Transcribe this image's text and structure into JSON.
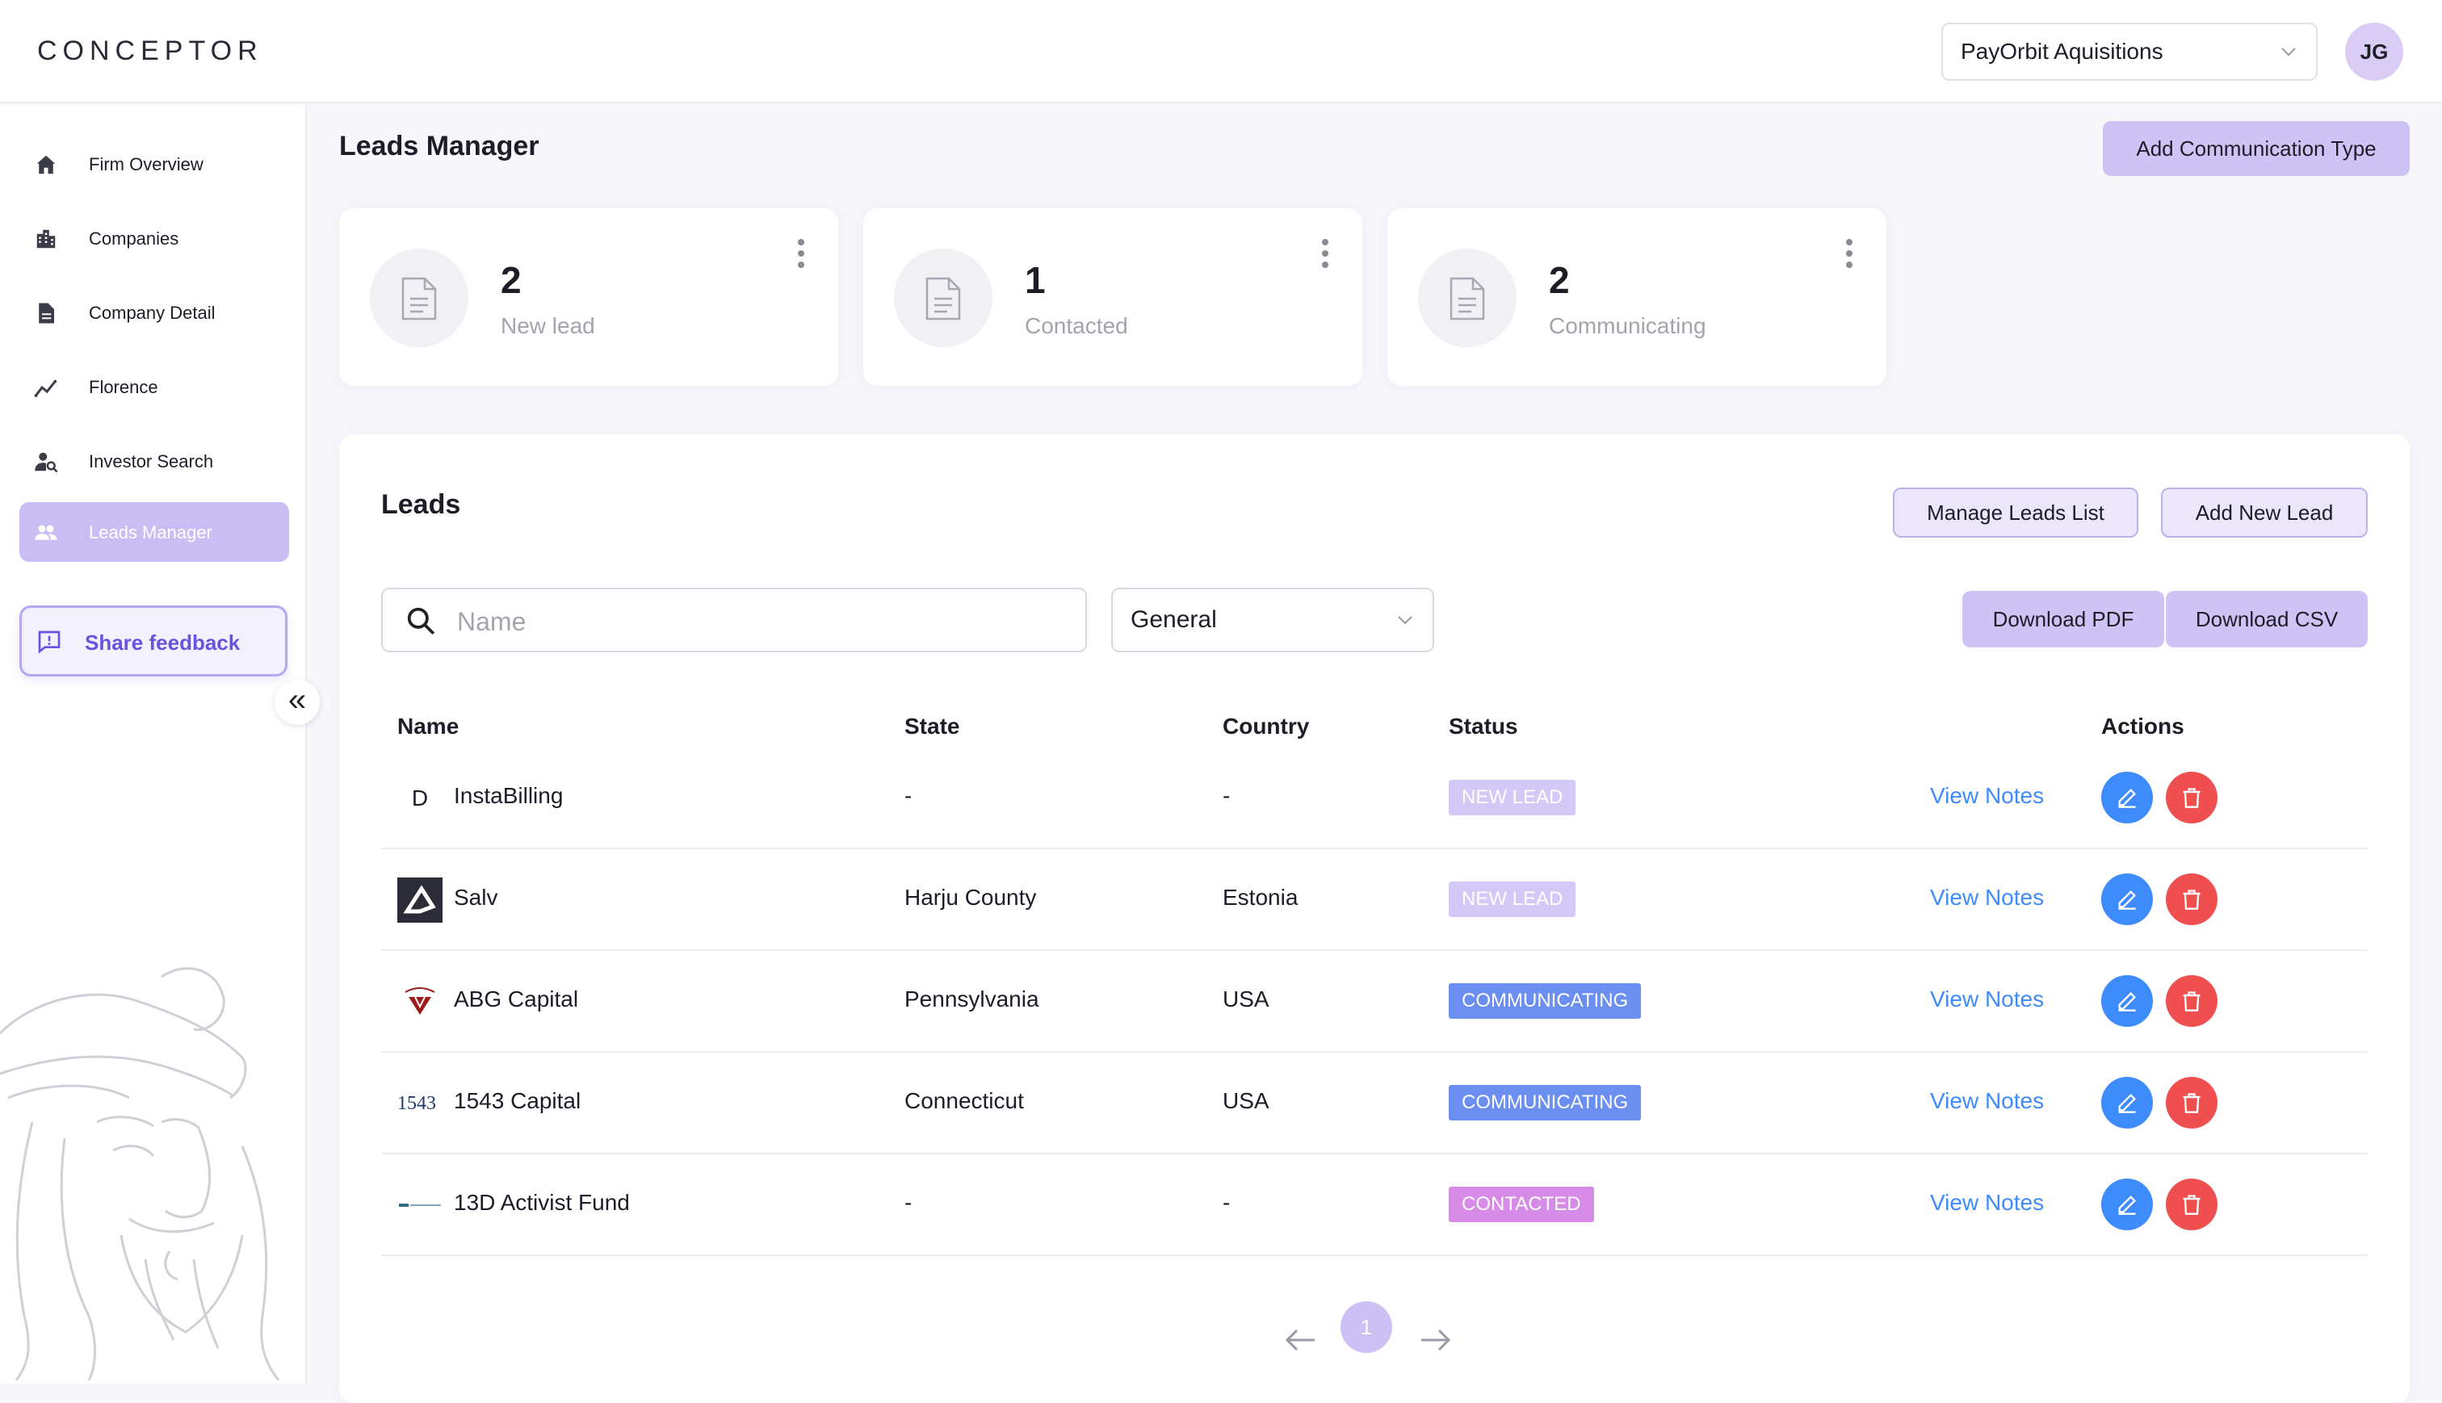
{
  "app": {
    "logo": "CONCEPTOR"
  },
  "header": {
    "firm_selected": "PayOrbit Aquisitions",
    "avatar_initials": "JG"
  },
  "sidebar": {
    "items": [
      {
        "label": "Firm Overview",
        "icon": "home-icon"
      },
      {
        "label": "Companies",
        "icon": "building-icon"
      },
      {
        "label": "Company Detail",
        "icon": "document-icon"
      },
      {
        "label": "Florence",
        "icon": "trend-icon"
      },
      {
        "label": "Investor Search",
        "icon": "person-search-icon"
      },
      {
        "label": "Leads Manager",
        "icon": "people-icon",
        "active": true
      }
    ],
    "feedback_label": "Share feedback"
  },
  "page": {
    "title": "Leads Manager",
    "add_comm_type_label": "Add Communication Type"
  },
  "stats": [
    {
      "value": "2",
      "label": "New lead"
    },
    {
      "value": "1",
      "label": "Contacted"
    },
    {
      "value": "2",
      "label": "Communicating"
    }
  ],
  "leads": {
    "title": "Leads",
    "manage_label": "Manage Leads List",
    "add_label": "Add New Lead",
    "search_placeholder": "Name",
    "category_selected": "General",
    "download_pdf_label": "Download PDF",
    "download_csv_label": "Download CSV",
    "columns": {
      "name": "Name",
      "state": "State",
      "country": "Country",
      "status": "Status",
      "actions": "Actions"
    },
    "rows": [
      {
        "name": "InstaBilling",
        "state": "-",
        "country": "-",
        "status": "NEW LEAD",
        "notes": "View Notes",
        "logo_text": "D"
      },
      {
        "name": "Salv",
        "state": "Harju County",
        "country": "Estonia",
        "status": "NEW LEAD",
        "notes": "View Notes"
      },
      {
        "name": "ABG Capital",
        "state": "Pennsylvania",
        "country": "USA",
        "status": "COMMUNICATING",
        "notes": "View Notes"
      },
      {
        "name": "1543 Capital",
        "state": "Connecticut",
        "country": "USA",
        "status": "COMMUNICATING",
        "notes": "View Notes",
        "logo_text": "1543"
      },
      {
        "name": "13D Activist Fund",
        "state": "-",
        "country": "-",
        "status": "CONTACTED",
        "notes": "View Notes"
      }
    ],
    "page_current": "1"
  },
  "colors": {
    "accent": "#c9bdf3",
    "status_new_lead": "#d4c8f7",
    "status_communicating": "#6a8ff0",
    "status_contacted": "#d68be6",
    "edit_button": "#3d8bfd",
    "delete_button": "#ef4f4f",
    "link": "#3d8bfd"
  }
}
